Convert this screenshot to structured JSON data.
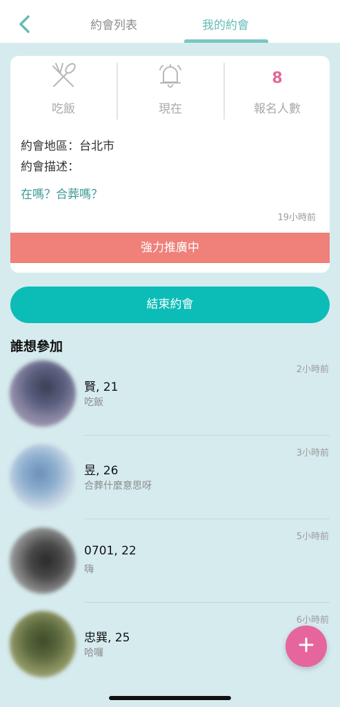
{
  "header": {
    "tabs": [
      {
        "label": "約會列表"
      },
      {
        "label": "我的約會"
      }
    ],
    "active_color": "#63bcb8"
  },
  "card": {
    "stats": [
      {
        "icon": "utensils-icon",
        "label": "吃飯"
      },
      {
        "icon": "bell-icon",
        "label": "現在"
      },
      {
        "value": "8",
        "label": "報名人數"
      }
    ],
    "location": "約會地區：台北市",
    "description_label": "約會描述：",
    "description": "在嗎？合葬嗎？",
    "time_ago": "19小時前",
    "promo": "強力推廣中"
  },
  "end_button": "結束約會",
  "section_title": "誰想參加",
  "participants": [
    {
      "name": "賢, 21",
      "message": "吃飯",
      "time": "2小時前"
    },
    {
      "name": "昱, 26",
      "message": "合葬什麼意思呀",
      "time": "3小時前"
    },
    {
      "name": "0701, 22",
      "message": "嗨",
      "time": "5小時前"
    },
    {
      "name": "忠巽, 25",
      "message": "哈囉",
      "time": "6小時前"
    }
  ],
  "colors": {
    "accent": "#0cbcb7",
    "promo": "#ef807a",
    "fab": "#e6659c",
    "count": "#e0699a"
  }
}
